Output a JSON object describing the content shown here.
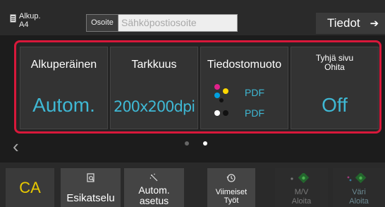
{
  "header": {
    "original_label": "Alkup.",
    "original_size": "A4",
    "address_label": "Osoite",
    "address_placeholder": "Sähköpostiosoite",
    "details_button": "Tiedot",
    "details_arrow": "➔"
  },
  "settings": {
    "original": {
      "title": "Alkuperäinen",
      "value": "Autom."
    },
    "resolution": {
      "title": "Tarkkuus",
      "value": "200x200dpi"
    },
    "file_format": {
      "title": "Tiedostomuoto",
      "color_value": "PDF",
      "mono_value": "PDF"
    },
    "blank_page": {
      "title_line1": "Tyhjä sivu",
      "title_line2": "Ohita",
      "value": "Off"
    }
  },
  "pager": {
    "prev_icon": "chevron-left-icon",
    "total_pages": 2,
    "current_page": 2
  },
  "bottom_bar": {
    "ca": "CA",
    "preview": "Esikatselu",
    "auto_set_line1": "Autom.",
    "auto_set_line2": "asetus",
    "recent_jobs_line1": "Viimeiset",
    "recent_jobs_line2": "Työt",
    "bw_start_line1": "M/V",
    "bw_start_line2": "Aloita",
    "color_start_line1": "Väri",
    "color_start_line2": "Aloita"
  },
  "colors": {
    "accent_value": "#3fb8d4",
    "highlight_border": "#d8183a",
    "ca_text": "#e8c900",
    "start_icon": "#2e8b3a"
  }
}
